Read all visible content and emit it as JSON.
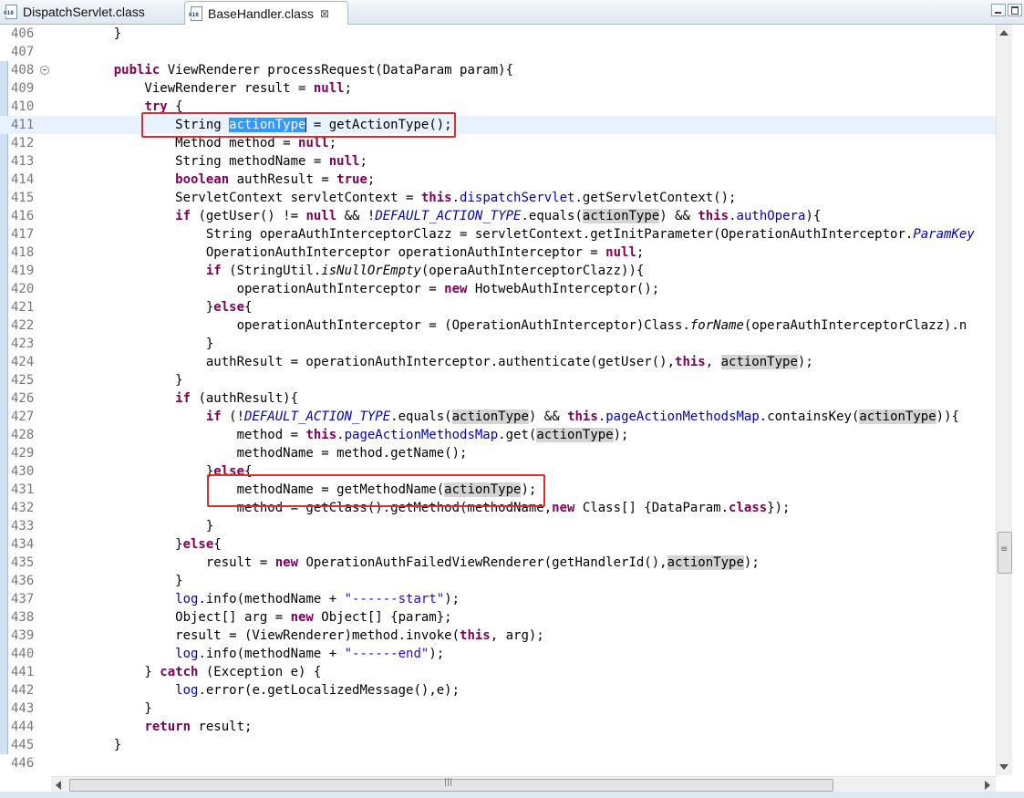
{
  "tabs": [
    {
      "label": "DispatchServlet.class",
      "icon": "class-file-icon",
      "active": false
    },
    {
      "label": "BaseHandler.class",
      "icon": "class-file-icon",
      "active": true,
      "close": "⊠"
    }
  ],
  "window_controls": [
    "minimize",
    "maximize"
  ],
  "editor": {
    "current_line": "411",
    "selected_text": "actionType",
    "lines": [
      {
        "n": "406",
        "segs": [
          [
            "p",
            "    }"
          ]
        ]
      },
      {
        "n": "407",
        "segs": []
      },
      {
        "n": "408",
        "fold": true,
        "segs": [
          [
            "p",
            "    "
          ],
          [
            "kw",
            "public"
          ],
          [
            "p",
            " ViewRenderer processRequest(DataParam param){"
          ]
        ]
      },
      {
        "n": "409",
        "segs": [
          [
            "p",
            "        ViewRenderer result = "
          ],
          [
            "kw",
            "null"
          ],
          [
            "p",
            ";"
          ]
        ]
      },
      {
        "n": "410",
        "segs": [
          [
            "p",
            "        "
          ],
          [
            "kw",
            "try"
          ],
          [
            "p",
            " {"
          ]
        ]
      },
      {
        "n": "411",
        "segs": [
          [
            "p",
            "            String "
          ],
          [
            "sel",
            "actionType"
          ],
          [
            "p",
            " = getActionType();"
          ]
        ]
      },
      {
        "n": "412",
        "segs": [
          [
            "p",
            "            Method method = "
          ],
          [
            "kw",
            "null"
          ],
          [
            "p",
            ";"
          ]
        ]
      },
      {
        "n": "413",
        "segs": [
          [
            "p",
            "            String methodName = "
          ],
          [
            "kw",
            "null"
          ],
          [
            "p",
            ";"
          ]
        ]
      },
      {
        "n": "414",
        "segs": [
          [
            "p",
            "            "
          ],
          [
            "kw",
            "boolean"
          ],
          [
            "p",
            " authResult = "
          ],
          [
            "kw",
            "true"
          ],
          [
            "p",
            ";"
          ]
        ]
      },
      {
        "n": "415",
        "segs": [
          [
            "p",
            "            ServletContext servletContext = "
          ],
          [
            "kw",
            "this"
          ],
          [
            "p",
            "."
          ],
          [
            "fld",
            "dispatchServlet"
          ],
          [
            "p",
            ".getServletContext();"
          ]
        ]
      },
      {
        "n": "416",
        "segs": [
          [
            "p",
            "            "
          ],
          [
            "kw",
            "if"
          ],
          [
            "p",
            " (getUser() != "
          ],
          [
            "kw",
            "null"
          ],
          [
            "p",
            " && !"
          ],
          [
            "sfi",
            "DEFAULT_ACTION_TYPE"
          ],
          [
            "p",
            ".equals("
          ],
          [
            "occ",
            "actionType"
          ],
          [
            "p",
            ") && "
          ],
          [
            "kw",
            "this"
          ],
          [
            "p",
            "."
          ],
          [
            "fld",
            "authOpera"
          ],
          [
            "p",
            "){"
          ]
        ]
      },
      {
        "n": "417",
        "segs": [
          [
            "p",
            "                String operaAuthInterceptorClazz = servletContext.getInitParameter(OperationAuthInterceptor."
          ],
          [
            "sfi",
            "ParamKey"
          ]
        ]
      },
      {
        "n": "418",
        "segs": [
          [
            "p",
            "                OperationAuthInterceptor operationAuthInterceptor = "
          ],
          [
            "kw",
            "null"
          ],
          [
            "p",
            ";"
          ]
        ]
      },
      {
        "n": "419",
        "segs": [
          [
            "p",
            "                "
          ],
          [
            "kw",
            "if"
          ],
          [
            "p",
            " (StringUtil."
          ],
          [
            "smi",
            "isNullOrEmpty"
          ],
          [
            "p",
            "(operaAuthInterceptorClazz)){"
          ]
        ]
      },
      {
        "n": "420",
        "segs": [
          [
            "p",
            "                    operationAuthInterceptor = "
          ],
          [
            "kw",
            "new"
          ],
          [
            "p",
            " HotwebAuthInterceptor();"
          ]
        ]
      },
      {
        "n": "421",
        "segs": [
          [
            "p",
            "                }"
          ],
          [
            "kw",
            "else"
          ],
          [
            "p",
            "{"
          ]
        ]
      },
      {
        "n": "422",
        "segs": [
          [
            "p",
            "                    operationAuthInterceptor = (OperationAuthInterceptor)Class."
          ],
          [
            "smi",
            "forName"
          ],
          [
            "p",
            "(operaAuthInterceptorClazz).n"
          ]
        ]
      },
      {
        "n": "423",
        "segs": [
          [
            "p",
            "                }"
          ]
        ]
      },
      {
        "n": "424",
        "segs": [
          [
            "p",
            "                authResult = operationAuthInterceptor.authenticate(getUser(),"
          ],
          [
            "kw",
            "this"
          ],
          [
            "p",
            ", "
          ],
          [
            "occ",
            "actionType"
          ],
          [
            "p",
            ");"
          ]
        ]
      },
      {
        "n": "425",
        "segs": [
          [
            "p",
            "            }"
          ]
        ]
      },
      {
        "n": "426",
        "segs": [
          [
            "p",
            "            "
          ],
          [
            "kw",
            "if"
          ],
          [
            "p",
            " (authResult){"
          ]
        ]
      },
      {
        "n": "427",
        "segs": [
          [
            "p",
            "                "
          ],
          [
            "kw",
            "if"
          ],
          [
            "p",
            " (!"
          ],
          [
            "sfi",
            "DEFAULT_ACTION_TYPE"
          ],
          [
            "p",
            ".equals("
          ],
          [
            "occ",
            "actionType"
          ],
          [
            "p",
            ") && "
          ],
          [
            "kw",
            "this"
          ],
          [
            "p",
            "."
          ],
          [
            "fld",
            "pageActionMethodsMap"
          ],
          [
            "p",
            ".containsKey("
          ],
          [
            "occ",
            "actionType"
          ],
          [
            "p",
            "))"
          ],
          [
            "p",
            "{"
          ]
        ]
      },
      {
        "n": "428",
        "segs": [
          [
            "p",
            "                    method = "
          ],
          [
            "kw",
            "this"
          ],
          [
            "p",
            "."
          ],
          [
            "fld",
            "pageActionMethodsMap"
          ],
          [
            "p",
            ".get("
          ],
          [
            "occ",
            "actionType"
          ],
          [
            "p",
            ");"
          ]
        ]
      },
      {
        "n": "429",
        "segs": [
          [
            "p",
            "                    methodName = method.getName();"
          ]
        ]
      },
      {
        "n": "430",
        "segs": [
          [
            "p",
            "                }"
          ],
          [
            "kw",
            "else"
          ],
          [
            "p",
            "{"
          ]
        ]
      },
      {
        "n": "431",
        "segs": [
          [
            "p",
            "                    methodName = getMethodName("
          ],
          [
            "occ",
            "actionType"
          ],
          [
            "p",
            ");"
          ]
        ]
      },
      {
        "n": "432",
        "segs": [
          [
            "p",
            "                    method = getClass().getMethod(methodName,"
          ],
          [
            "kw",
            "new"
          ],
          [
            "p",
            " Class[] {DataParam."
          ],
          [
            "kw",
            "class"
          ],
          [
            "p",
            "});"
          ]
        ]
      },
      {
        "n": "433",
        "segs": [
          [
            "p",
            "                }"
          ]
        ]
      },
      {
        "n": "434",
        "segs": [
          [
            "p",
            "            }"
          ],
          [
            "kw",
            "else"
          ],
          [
            "p",
            "{"
          ]
        ]
      },
      {
        "n": "435",
        "segs": [
          [
            "p",
            "                result = "
          ],
          [
            "kw",
            "new"
          ],
          [
            "p",
            " OperationAuthFailedViewRenderer(getHandlerId(),"
          ],
          [
            "occ",
            "actionType"
          ],
          [
            "p",
            ");"
          ]
        ]
      },
      {
        "n": "436",
        "segs": [
          [
            "p",
            "            }"
          ]
        ]
      },
      {
        "n": "437",
        "segs": [
          [
            "p",
            "            "
          ],
          [
            "fld",
            "log"
          ],
          [
            "p",
            ".info(methodName + "
          ],
          [
            "str",
            "\"------start\""
          ],
          [
            "p",
            ");"
          ]
        ]
      },
      {
        "n": "438",
        "segs": [
          [
            "p",
            "            Object[] arg = "
          ],
          [
            "kw",
            "new"
          ],
          [
            "p",
            " Object[] {param};"
          ]
        ]
      },
      {
        "n": "439",
        "segs": [
          [
            "p",
            "            result = (ViewRenderer)method.invoke("
          ],
          [
            "kw",
            "this"
          ],
          [
            "p",
            ", arg);"
          ]
        ]
      },
      {
        "n": "440",
        "segs": [
          [
            "p",
            "            "
          ],
          [
            "fld",
            "log"
          ],
          [
            "p",
            ".info(methodName + "
          ],
          [
            "str",
            "\"------end\""
          ],
          [
            "p",
            ");"
          ]
        ]
      },
      {
        "n": "441",
        "segs": [
          [
            "p",
            "        } "
          ],
          [
            "kw",
            "catch"
          ],
          [
            "p",
            " (Exception e) {"
          ]
        ]
      },
      {
        "n": "442",
        "segs": [
          [
            "p",
            "            "
          ],
          [
            "fld",
            "log"
          ],
          [
            "p",
            ".error(e.getLocalizedMessage(),e);"
          ]
        ]
      },
      {
        "n": "443",
        "segs": [
          [
            "p",
            "        }"
          ]
        ]
      },
      {
        "n": "444",
        "segs": [
          [
            "p",
            "        "
          ],
          [
            "kw",
            "return"
          ],
          [
            "p",
            " result;"
          ]
        ]
      },
      {
        "n": "445",
        "segs": [
          [
            "p",
            "    }"
          ]
        ]
      },
      {
        "n": "446",
        "segs": []
      }
    ]
  },
  "annotations": [
    {
      "line": "411",
      "text": "String actionType = getActionType();"
    },
    {
      "line": "431",
      "text": "methodName = getMethodName(actionType);"
    }
  ],
  "colors": {
    "keyword": "#7f0055",
    "field": "#0000c0",
    "string": "#2a00ff",
    "line_number": "#787878",
    "current_line": "#e8f2fe",
    "selection": "#3399ff",
    "occurrence": "#d4d4d4",
    "annotation_box": "#e22b2b"
  }
}
